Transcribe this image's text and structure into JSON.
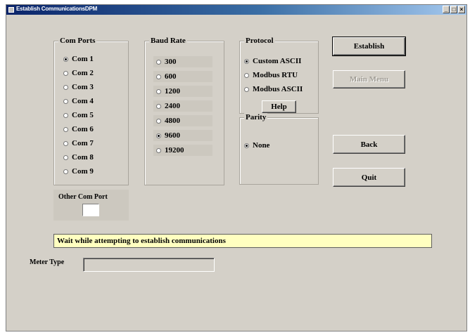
{
  "window": {
    "title": "Establish CommunicationsDPM"
  },
  "com_ports": {
    "title": "Com Ports",
    "items": [
      "Com 1",
      "Com 2",
      "Com 3",
      "Com 4",
      "Com 5",
      "Com 6",
      "Com 7",
      "Com 8",
      "Com 9"
    ],
    "selected": "Com 1"
  },
  "other_com_port": {
    "label": "Other Com Port",
    "value": ""
  },
  "baud_rate": {
    "title": "Baud Rate",
    "items": [
      "300",
      "600",
      "1200",
      "2400",
      "4800",
      "9600",
      "19200"
    ],
    "selected": "9600"
  },
  "protocol": {
    "title": "Protocol",
    "items": [
      "Custom ASCII",
      "Modbus RTU",
      "Modbus ASCII"
    ],
    "selected": "Custom ASCII",
    "help_label": "Help"
  },
  "parity": {
    "title": "Parity",
    "items": [
      "None"
    ],
    "selected": "None"
  },
  "buttons": {
    "establish": "Establish",
    "main_menu": "Main Menu",
    "back": "Back",
    "quit": "Quit"
  },
  "status": {
    "message": "Wait while attempting to establish communications"
  },
  "meter_type": {
    "label": "Meter Type",
    "value": ""
  }
}
